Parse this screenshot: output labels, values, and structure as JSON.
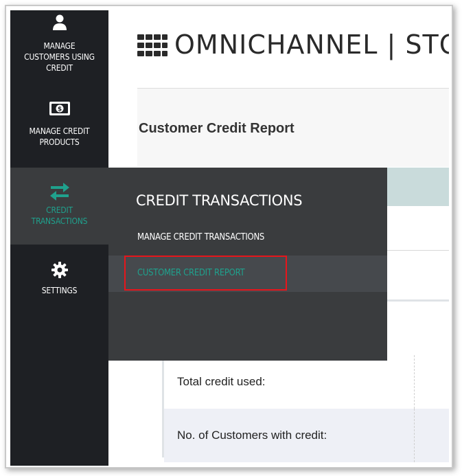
{
  "sidebar": {
    "items": [
      {
        "label_lines": [
          "MANAGE",
          "CUSTOMERS USING",
          "CREDIT"
        ],
        "icon": "user-icon"
      },
      {
        "label_lines": [
          "MANAGE CREDIT",
          "PRODUCTS"
        ],
        "icon": "money-icon"
      },
      {
        "label_lines": [
          "CREDIT",
          "TRANSACTIONS"
        ],
        "icon": "swap-arrows-icon",
        "active": true
      },
      {
        "label_lines": [
          "SETTINGS"
        ],
        "icon": "gear-icon"
      }
    ]
  },
  "header": {
    "title": "OMNICHANNEL | STO",
    "icon": "grid-icon"
  },
  "card": {
    "title": "Customer Credit Report"
  },
  "table": {
    "rows": [
      {
        "label": "Total credit used:"
      },
      {
        "label": "No. of Customers with credit:"
      }
    ]
  },
  "flyout": {
    "title": "CREDIT TRANSACTIONS",
    "items": [
      {
        "label": "MANAGE CREDIT TRANSACTIONS"
      },
      {
        "label": "CUSTOMER CREDIT REPORT",
        "selected": true
      }
    ]
  },
  "colors": {
    "sidebar_bg": "#1e2024",
    "flyout_bg": "#3a3c3e",
    "accent_teal": "#1fa18d",
    "highlight_red": "#e8151b"
  }
}
